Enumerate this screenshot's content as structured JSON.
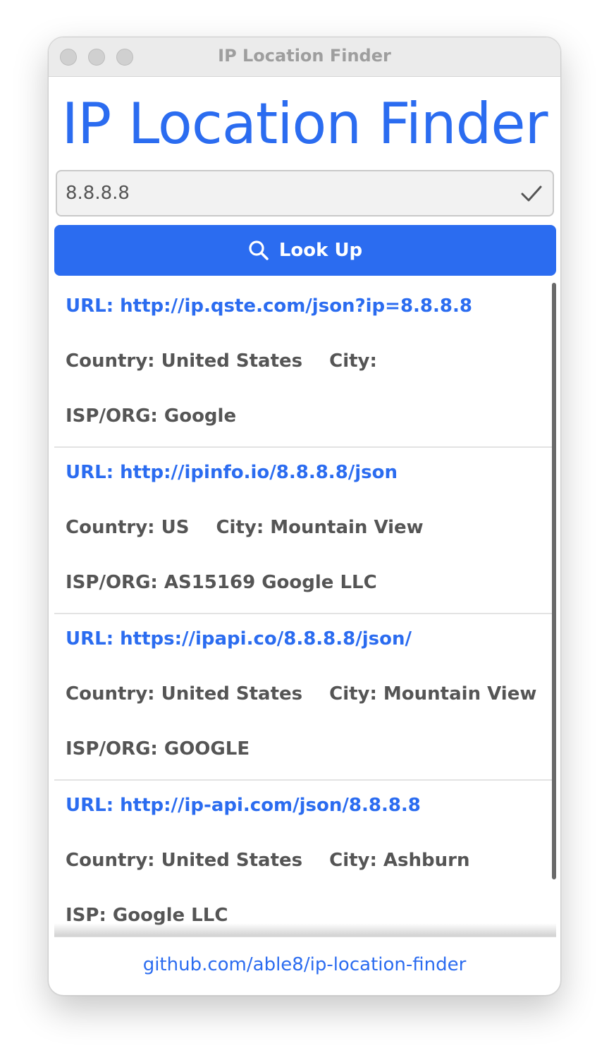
{
  "window": {
    "title": "IP Location Finder"
  },
  "app": {
    "heading": "IP Location Finder"
  },
  "ip_input": {
    "value": "8.8.8.8",
    "placeholder": ""
  },
  "lookup_button": {
    "label": "Look Up"
  },
  "results": [
    {
      "url_label": "URL: http://ip.qste.com/json?ip=8.8.8.8",
      "country": "Country: United States",
      "city": "City:",
      "isp": "ISP/ORG: Google"
    },
    {
      "url_label": "URL: http://ipinfo.io/8.8.8.8/json",
      "country": "Country: US",
      "city": "City: Mountain View",
      "isp": "ISP/ORG: AS15169 Google LLC"
    },
    {
      "url_label": "URL: https://ipapi.co/8.8.8.8/json/",
      "country": "Country: United States",
      "city": "City: Mountain View",
      "isp": "ISP/ORG: GOOGLE"
    },
    {
      "url_label": "URL: http://ip-api.com/json/8.8.8.8",
      "country": "Country: United States",
      "city": "City: Ashburn",
      "isp": "ISP: Google LLC"
    }
  ],
  "footer": {
    "link": "github.com/able8/ip-location-finder"
  },
  "colors": {
    "accent": "#2b6cf0",
    "text": "#555555"
  },
  "icons": {
    "input_status": "check-icon",
    "button": "search-icon"
  }
}
